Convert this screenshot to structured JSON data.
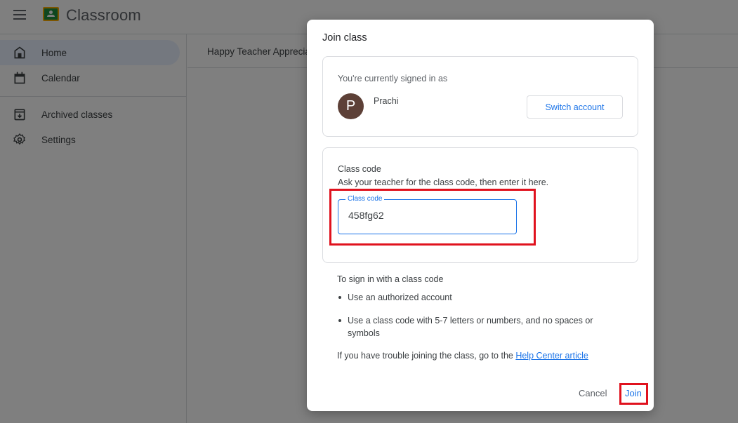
{
  "app": {
    "title": "Classroom",
    "menu_icon": "hamburger-menu-icon",
    "logo_icon": "classroom-logo-icon"
  },
  "sidebar": {
    "items": [
      {
        "label": "Home",
        "icon": "home-icon",
        "active": true
      },
      {
        "label": "Calendar",
        "icon": "calendar-icon",
        "active": false
      },
      {
        "label": "Archived classes",
        "icon": "archive-icon",
        "active": false
      },
      {
        "label": "Settings",
        "icon": "gear-icon",
        "active": false
      }
    ]
  },
  "main": {
    "tab_label": "Happy Teacher Apprecia"
  },
  "dialog": {
    "title": "Join class",
    "account": {
      "signed_in_label": "You're currently signed in as",
      "avatar_initial": "P",
      "avatar_color": "#5d4037",
      "user_name": "Prachi",
      "switch_button": "Switch account"
    },
    "class_code": {
      "title": "Class code",
      "description": "Ask your teacher for the class code, then enter it here.",
      "field_label": "Class code",
      "value": "458fg62"
    },
    "instructions": {
      "title": "To sign in with a class code",
      "bullets": [
        "Use an authorized account",
        "Use a class code with 5-7 letters or numbers, and no spaces or symbols"
      ],
      "help_prefix": "If you have trouble joining the class, go to the ",
      "help_link": "Help Center article"
    },
    "cancel_button": "Cancel",
    "join_button": "Join"
  },
  "colors": {
    "accent": "#1a73e8",
    "highlight": "#e0121e",
    "active_nav": "#e8f0fe"
  }
}
